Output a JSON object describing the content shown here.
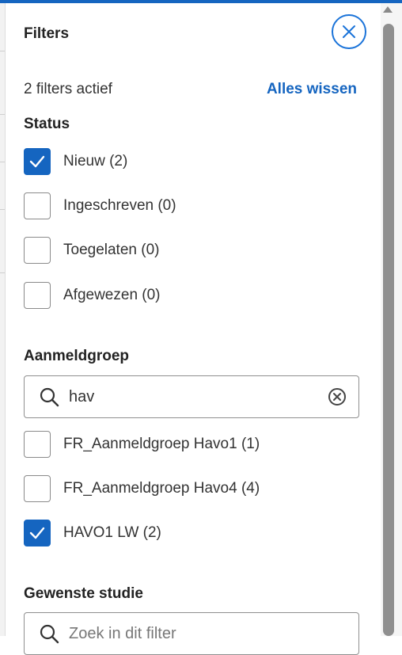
{
  "panel": {
    "title": "Filters",
    "active_count": "2 filters actief",
    "clear_all": "Alles wissen"
  },
  "status": {
    "title": "Status",
    "options": [
      {
        "label": "Nieuw (2)",
        "checked": true
      },
      {
        "label": "Ingeschreven (0)",
        "checked": false
      },
      {
        "label": "Toegelaten (0)",
        "checked": false
      },
      {
        "label": "Afgewezen (0)",
        "checked": false
      }
    ]
  },
  "aanmeldgroep": {
    "title": "Aanmeldgroep",
    "search_value": "hav",
    "options": [
      {
        "label": "FR_Aanmeldgroep Havo1 (1)",
        "checked": false
      },
      {
        "label": "FR_Aanmeldgroep Havo4 (4)",
        "checked": false
      },
      {
        "label": "HAVO1 LW (2)",
        "checked": true
      }
    ]
  },
  "gewenste_studie": {
    "title": "Gewenste studie",
    "search_placeholder": "Zoek in dit filter"
  },
  "colors": {
    "accent": "#1565c0",
    "checkbox_border": "#8a8a8a"
  }
}
